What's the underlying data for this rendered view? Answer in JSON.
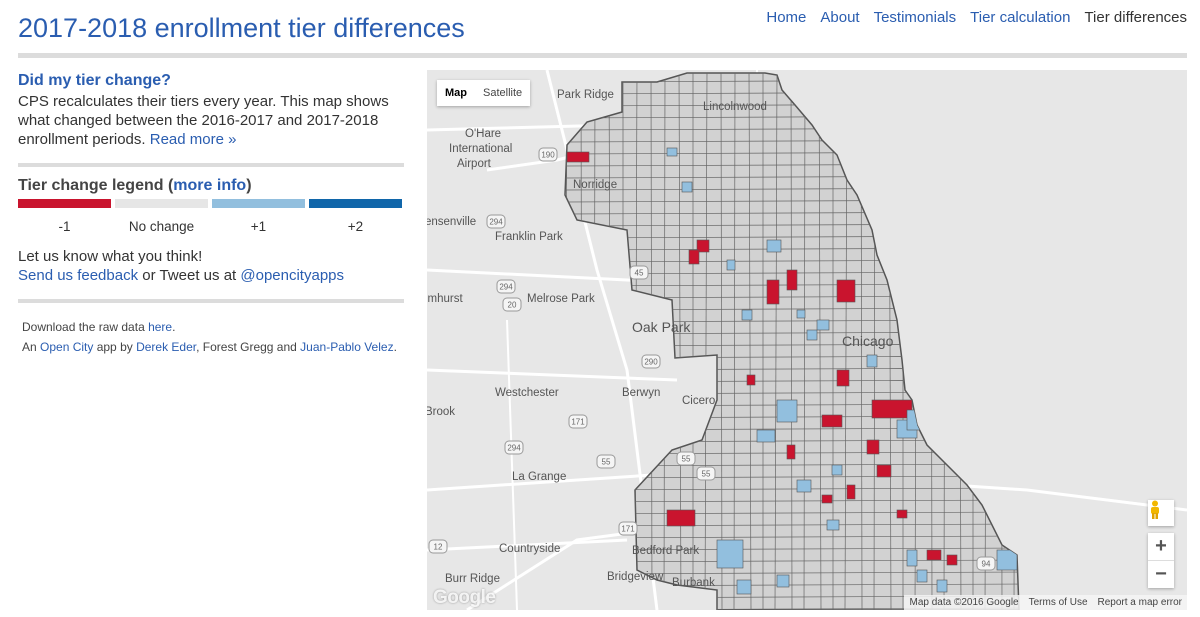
{
  "header": {
    "title": "2017-2018 enrollment tier differences",
    "nav": [
      "Home",
      "About",
      "Testimonials",
      "Tier calculation",
      "Tier differences"
    ]
  },
  "intro": {
    "heading": "Did my tier change?",
    "text": "CPS recalculates their tiers every year. This map shows what changed between the 2016-2017 and 2017-2018 enrollment periods. ",
    "read_more": "Read more »"
  },
  "legend": {
    "title": "Tier change legend (",
    "more_info": "more info",
    "title_close": ")",
    "items": [
      {
        "label": "-1",
        "color": "#c9142e"
      },
      {
        "label": "No change",
        "color": "#e6e6e6"
      },
      {
        "label": "+1",
        "color": "#92bfde"
      },
      {
        "label": "+2",
        "color": "#1066aa"
      }
    ]
  },
  "feedback": {
    "line1": "Let us know what you think!",
    "send": "Send us feedback",
    "or": " or Tweet us at ",
    "twitter": "@opencityapps"
  },
  "credits": {
    "download_pre": "Download the raw data ",
    "here": "here",
    "download_post": ".",
    "an": "An ",
    "open_city": "Open City",
    "app_by": " app by ",
    "derek": "Derek Eder",
    "mid": ", Forest Gregg and ",
    "juan": "Juan-Pablo Velez",
    "end": "."
  },
  "map": {
    "type_map": "Map",
    "type_satellite": "Satellite",
    "zoom_in": "+",
    "zoom_out": "−",
    "google": "Google",
    "attribution": [
      "Map data ©2016 Google",
      "Terms of Use",
      "Report a map error"
    ],
    "places": [
      "Park Ridge",
      "Lincolnwood",
      "O'Hare",
      "International",
      "Airport",
      "Norridge",
      "ensenville",
      "Franklin Park",
      "lmhurst",
      "Melrose Park",
      "Oak Park",
      "Chicago",
      "Westchester",
      "Berwyn",
      "Cicero",
      "Brook",
      "La Grange",
      "Countryside",
      "Bedford Park",
      "Burr Ridge",
      "Bridgeview",
      "Burbank"
    ],
    "road_numbers": [
      "294",
      "190",
      "45",
      "294",
      "20",
      "290",
      "171",
      "55",
      "55",
      "294",
      "171",
      "55",
      "12",
      "94"
    ]
  },
  "colors": {
    "link": "#2a5db0",
    "tier_minus1": "#c9142e",
    "tier_same": "#e6e6e6",
    "tier_plus1": "#92bfde",
    "tier_plus2": "#1066aa"
  }
}
